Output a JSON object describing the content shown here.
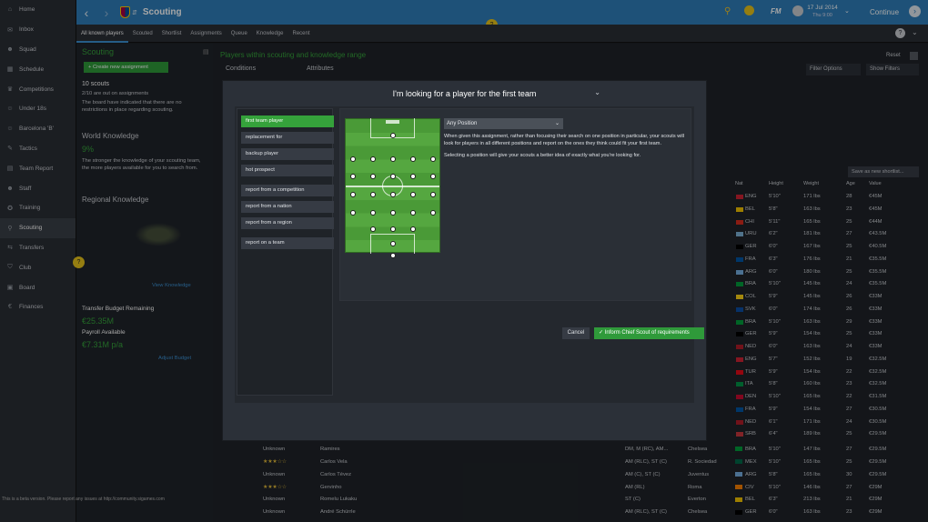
{
  "sidebar": {
    "items": [
      {
        "icon": "home-icon",
        "label": "Home"
      },
      {
        "icon": "inbox-icon",
        "label": "Inbox"
      },
      {
        "icon": "squad-icon",
        "label": "Squad"
      },
      {
        "icon": "schedule-icon",
        "label": "Schedule"
      },
      {
        "icon": "trophy-icon",
        "label": "Competitions"
      },
      {
        "icon": "under18-icon",
        "label": "Under 18s"
      },
      {
        "icon": "team-b-icon",
        "label": "Barcelona 'B'"
      },
      {
        "icon": "tactics-icon",
        "label": "Tactics"
      },
      {
        "icon": "report-icon",
        "label": "Team Report"
      },
      {
        "icon": "staff-icon",
        "label": "Staff"
      },
      {
        "icon": "training-icon",
        "label": "Training"
      },
      {
        "icon": "scouting-icon",
        "label": "Scouting"
      },
      {
        "icon": "transfers-icon",
        "label": "Transfers"
      },
      {
        "icon": "club-icon",
        "label": "Club"
      },
      {
        "icon": "board-icon",
        "label": "Board"
      },
      {
        "icon": "finances-icon",
        "label": "Finances"
      }
    ]
  },
  "header": {
    "title": "Scouting",
    "date": "17 Jul 2014",
    "day": "Thu 9:00",
    "continue": "Continue",
    "fm_label": "FM"
  },
  "tabs": [
    "All known players",
    "Scouted",
    "Shortlist",
    "Assignments",
    "Queue",
    "Knowledge",
    "Recent"
  ],
  "left": {
    "heading": "Scouting",
    "create_btn": "+ Create new assignment",
    "scouts": "10 scouts",
    "out": "2/10 are out on assignments",
    "board_note": "The board have indicated that there are no restrictions in place regarding scouting.",
    "world_title": "World Knowledge",
    "world_pct": "9%",
    "world_desc": "The stronger the knowledge of your scouting team, the more players available for you to search from.",
    "regional_title": "Regional Knowledge",
    "view_knowledge": "View Knowledge",
    "budget_title": "Transfer Budget Remaining",
    "budget_val": "€25.35M",
    "payroll_title": "Payroll Available",
    "payroll_val": "€7.31M p/a",
    "adjust": "Adjust Budget"
  },
  "right": {
    "header": "Players within scouting and knowledge range",
    "conditions": "Conditions",
    "attributes": "Attributes",
    "reset": "Reset",
    "filter_options": "Filter Options",
    "show_filters": "Show Filters",
    "save_shortlist": "Save as new shortlist...",
    "cols": {
      "nat": "Nat",
      "height": "Height",
      "weight": "Weight",
      "age": "Age",
      "value": "Value"
    }
  },
  "modal": {
    "title": "I'm looking for a player for the first team",
    "options": [
      "first team player",
      "replacement for",
      "backup player",
      "hot prospect",
      "report from a competition",
      "report from a nation",
      "report from a region",
      "report on a team"
    ],
    "position": "Any Position",
    "desc1": "When given this assignment, rather than focusing their search on one position in particular, your scouts will look for players in all different positions and report on the ones they think could fit your first team.",
    "desc2": "Selecting a position will give your scouts a better idea of exactly what you're looking for.",
    "cancel": "Cancel",
    "ok": "Inform Chief Scout of requirements"
  },
  "overlay_rows": [
    {
      "nat": "ENG",
      "h": "5'10\"",
      "w": "171 lbs",
      "a": "28",
      "v": "€45M",
      "c": "#cc2233"
    },
    {
      "nat": "BEL",
      "h": "5'8\"",
      "w": "163 lbs",
      "a": "23",
      "v": "€45M",
      "c": "#f2c200"
    },
    {
      "nat": "CHI",
      "h": "5'11\"",
      "w": "165 lbs",
      "a": "25",
      "v": "€44M",
      "c": "#d52b1e"
    },
    {
      "nat": "URU",
      "h": "6'2\"",
      "w": "181 lbs",
      "a": "27",
      "v": "€43.5M",
      "c": "#7bafd4"
    },
    {
      "nat": "GER",
      "h": "6'0\"",
      "w": "167 lbs",
      "a": "25",
      "v": "€40.5M",
      "c": "#000000"
    },
    {
      "nat": "FRA",
      "h": "6'3\"",
      "w": "176 lbs",
      "a": "21",
      "v": "€35.5M",
      "c": "#0055a4"
    },
    {
      "nat": "ARG",
      "h": "6'0\"",
      "w": "180 lbs",
      "a": "25",
      "v": "€35.5M",
      "c": "#74acdf"
    },
    {
      "nat": "BRA",
      "h": "5'10\"",
      "w": "145 lbs",
      "a": "24",
      "v": "€35.5M",
      "c": "#009c3b"
    },
    {
      "nat": "COL",
      "h": "5'9\"",
      "w": "145 lbs",
      "a": "26",
      "v": "€33M",
      "c": "#fcd116"
    },
    {
      "nat": "SVK",
      "h": "6'0\"",
      "w": "174 lbs",
      "a": "26",
      "v": "€33M",
      "c": "#0b4ea2"
    },
    {
      "nat": "BRA",
      "h": "5'10\"",
      "w": "163 lbs",
      "a": "29",
      "v": "€33M",
      "c": "#009c3b"
    },
    {
      "nat": "GER",
      "h": "5'9\"",
      "w": "154 lbs",
      "a": "25",
      "v": "€33M",
      "c": "#000000"
    },
    {
      "nat": "NED",
      "h": "6'0\"",
      "w": "163 lbs",
      "a": "24",
      "v": "€33M",
      "c": "#ae1c28"
    },
    {
      "nat": "ENG",
      "h": "5'7\"",
      "w": "152 lbs",
      "a": "19",
      "v": "€32.5M",
      "c": "#cc2233"
    },
    {
      "nat": "TUR",
      "h": "5'9\"",
      "w": "154 lbs",
      "a": "22",
      "v": "€32.5M",
      "c": "#e30a17"
    },
    {
      "nat": "ITA",
      "h": "5'8\"",
      "w": "160 lbs",
      "a": "23",
      "v": "€32.5M",
      "c": "#009246"
    },
    {
      "nat": "DEN",
      "h": "5'10\"",
      "w": "165 lbs",
      "a": "22",
      "v": "€31.5M",
      "c": "#c60c30"
    },
    {
      "nat": "FRA",
      "h": "5'9\"",
      "w": "154 lbs",
      "a": "27",
      "v": "€30.5M",
      "c": "#0055a4"
    },
    {
      "nat": "NED",
      "h": "6'1\"",
      "w": "171 lbs",
      "a": "24",
      "v": "€30.5M",
      "c": "#ae1c28"
    },
    {
      "nat": "SRB",
      "h": "6'4\"",
      "w": "189 lbs",
      "a": "25",
      "v": "€29.5M",
      "c": "#c6363c"
    }
  ],
  "bottom_rows": [
    {
      "stars": "Unknown",
      "name": "Ramires",
      "pos": "DM, M (RC), AM...",
      "club": "Chelsea",
      "nat": "BRA",
      "h": "5'10\"",
      "w": "147 lbs",
      "a": "27",
      "v": "€29.5M",
      "c": "#009c3b"
    },
    {
      "stars": "★★★☆☆",
      "name": "Carlos Vela",
      "pos": "AM (RLC), ST (C)",
      "club": "R. Sociedad",
      "nat": "MEX",
      "h": "5'10\"",
      "w": "165 lbs",
      "a": "25",
      "v": "€29.5M",
      "c": "#006847"
    },
    {
      "stars": "Unknown",
      "name": "Carlos Tévez",
      "pos": "AM (C), ST (C)",
      "club": "Juventus",
      "nat": "ARG",
      "h": "5'8\"",
      "w": "165 lbs",
      "a": "30",
      "v": "€29.5M",
      "c": "#74acdf"
    },
    {
      "stars": "★★★☆☆",
      "name": "Gervinho",
      "pos": "AM (RL)",
      "club": "Roma",
      "nat": "CIV",
      "h": "5'10\"",
      "w": "146 lbs",
      "a": "27",
      "v": "€29M",
      "c": "#f77f00"
    },
    {
      "stars": "Unknown",
      "name": "Romelu Lukaku",
      "pos": "ST (C)",
      "club": "Everton",
      "nat": "BEL",
      "h": "6'3\"",
      "w": "213 lbs",
      "a": "21",
      "v": "€29M",
      "c": "#f2c200"
    },
    {
      "stars": "Unknown",
      "name": "André Schürrle",
      "pos": "AM (RLC), ST (C)",
      "club": "Chelsea",
      "nat": "GER",
      "h": "6'0\"",
      "w": "163 lbs",
      "a": "23",
      "v": "€29M",
      "c": "#000000"
    }
  ],
  "beta_text": "This is a beta version. Please report any issues at http://community.sigames.com"
}
